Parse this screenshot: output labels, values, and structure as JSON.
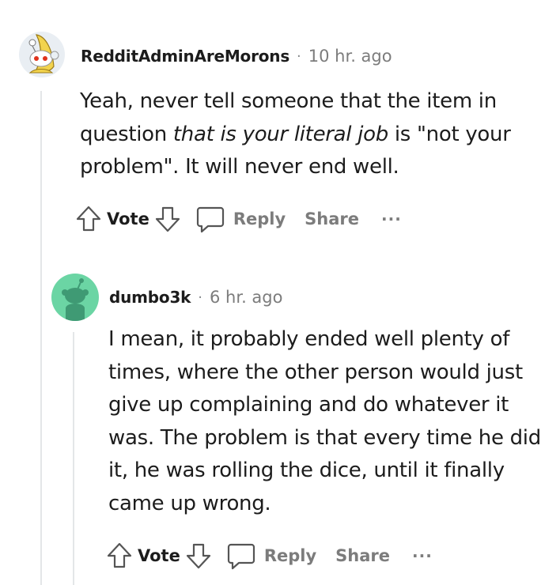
{
  "comments": [
    {
      "username": "RedditAdminAreMorons",
      "separator": "·",
      "time": "10 hr. ago",
      "body_part1": "Yeah, never tell someone that the item in question ",
      "body_italic": "that is your literal job",
      "body_part2": " is \"not your problem\". It will never end well.",
      "vote_label": "Vote",
      "reply_label": "Reply",
      "share_label": "Share",
      "more_label": "···",
      "avatar_icon": "snoo-banana-avatar"
    },
    {
      "username": "dumbo3k",
      "separator": "·",
      "time": "6 hr. ago",
      "body": "I mean, it probably ended well plenty of times, where the other person would just give up complaining and do whatever it was. The problem is that every time he did it, he was rolling the dice, until it finally came up wrong.",
      "vote_label": "Vote",
      "reply_label": "Reply",
      "share_label": "Share",
      "more_label": "···",
      "avatar_icon": "default-snoo-avatar"
    }
  ],
  "colors": {
    "text": "#1c1c1c",
    "muted": "#7c7c7c",
    "thread_line": "#e4e6e8",
    "avatar_teal": "#6bd5a4"
  }
}
